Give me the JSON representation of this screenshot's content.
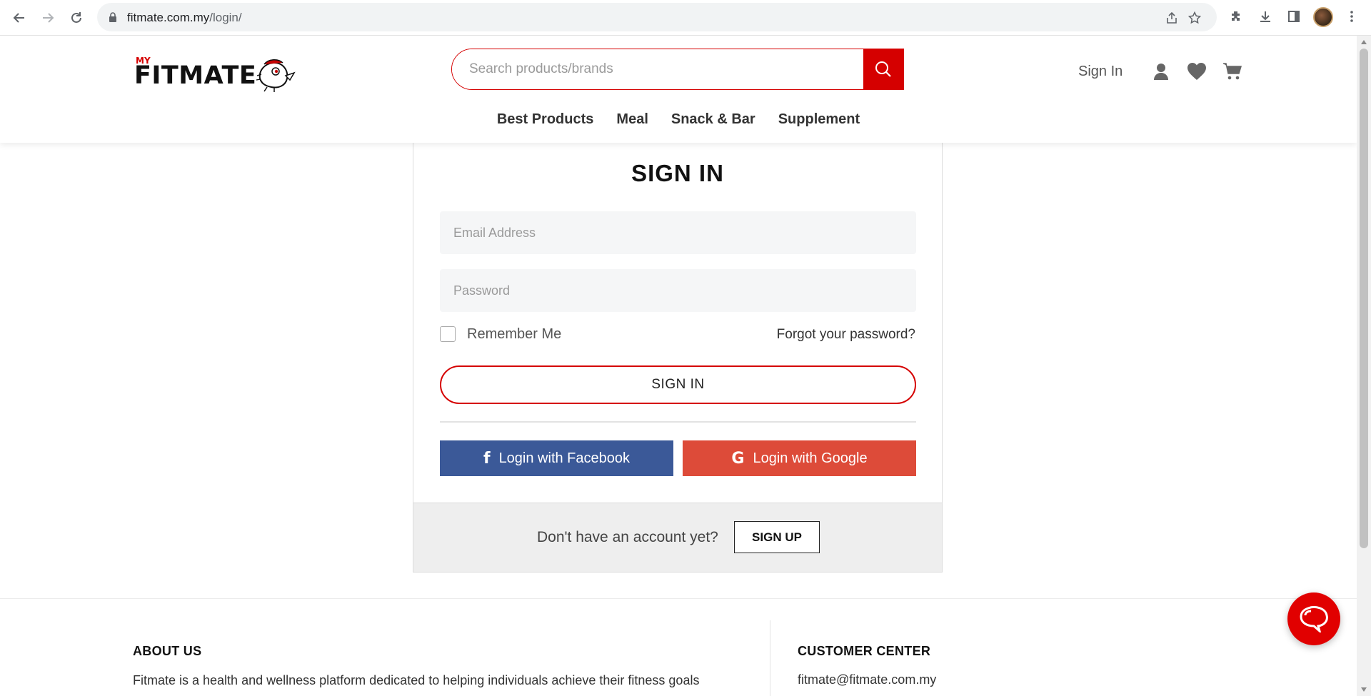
{
  "browser": {
    "url_domain": "fitmate.com.my",
    "url_path": "/login/"
  },
  "header": {
    "logo_prefix": "MY",
    "logo_text": "FITMATE",
    "search_placeholder": "Search products/brands",
    "signin_label": "Sign In",
    "nav": [
      "Best Products",
      "Meal",
      "Snack & Bar",
      "Supplement"
    ]
  },
  "login": {
    "title": "SIGN IN",
    "email_placeholder": "Email Address",
    "password_placeholder": "Password",
    "remember_label": "Remember Me",
    "forgot_label": "Forgot your password?",
    "submit_label": "SIGN IN",
    "facebook_label": "Login with Facebook",
    "google_label": "Login with Google",
    "signup_prompt": "Don't have an account yet?",
    "signup_label": "SIGN UP"
  },
  "footer": {
    "about_heading": "ABOUT US",
    "about_text": "Fitmate is a health and wellness platform dedicated to helping individuals achieve their fitness goals",
    "cc_heading": "CUSTOMER CENTER",
    "cc_email": "fitmate@fitmate.com.my"
  },
  "colors": {
    "brand_red": "#d50000",
    "facebook_blue": "#3b5998",
    "google_red": "#dd4b39"
  }
}
